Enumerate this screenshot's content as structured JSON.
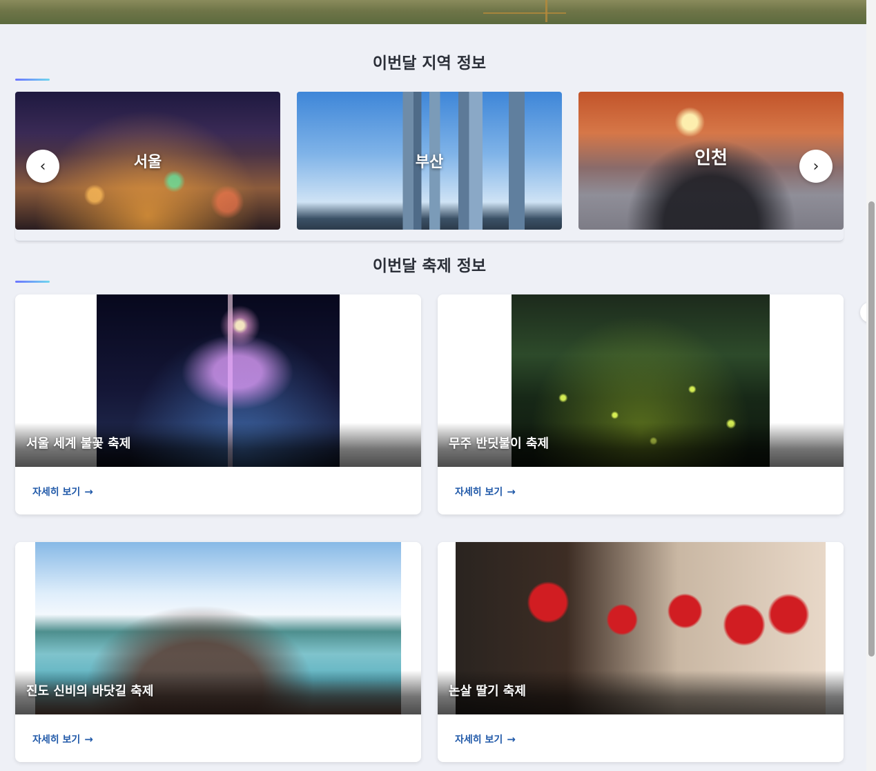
{
  "sections": {
    "region_title": "이번달 지역 정보",
    "festival_title": "이번달 축제 정보"
  },
  "regions": [
    {
      "name": "서울"
    },
    {
      "name": "부산"
    },
    {
      "name": "인천"
    }
  ],
  "carousel": {
    "prev_icon": "chevron-left-icon",
    "next_icon": "chevron-right-icon"
  },
  "festivals": [
    {
      "title": "서울 세계 불꽃 축제",
      "link_label": "자세히 보기"
    },
    {
      "title": "무주 반딧불이 축제",
      "link_label": "자세히 보기"
    },
    {
      "title": "진도 신비의 바닷길 축제",
      "link_label": "자세히 보기"
    },
    {
      "title": "논살 딸기 축제",
      "link_label": "자세히 보기"
    }
  ],
  "colors": {
    "background": "#eef0f6",
    "heading": "#2b2f38",
    "link": "#1f58a8",
    "accent_start": "#6b74ff",
    "accent_end": "#6fd6ee"
  }
}
